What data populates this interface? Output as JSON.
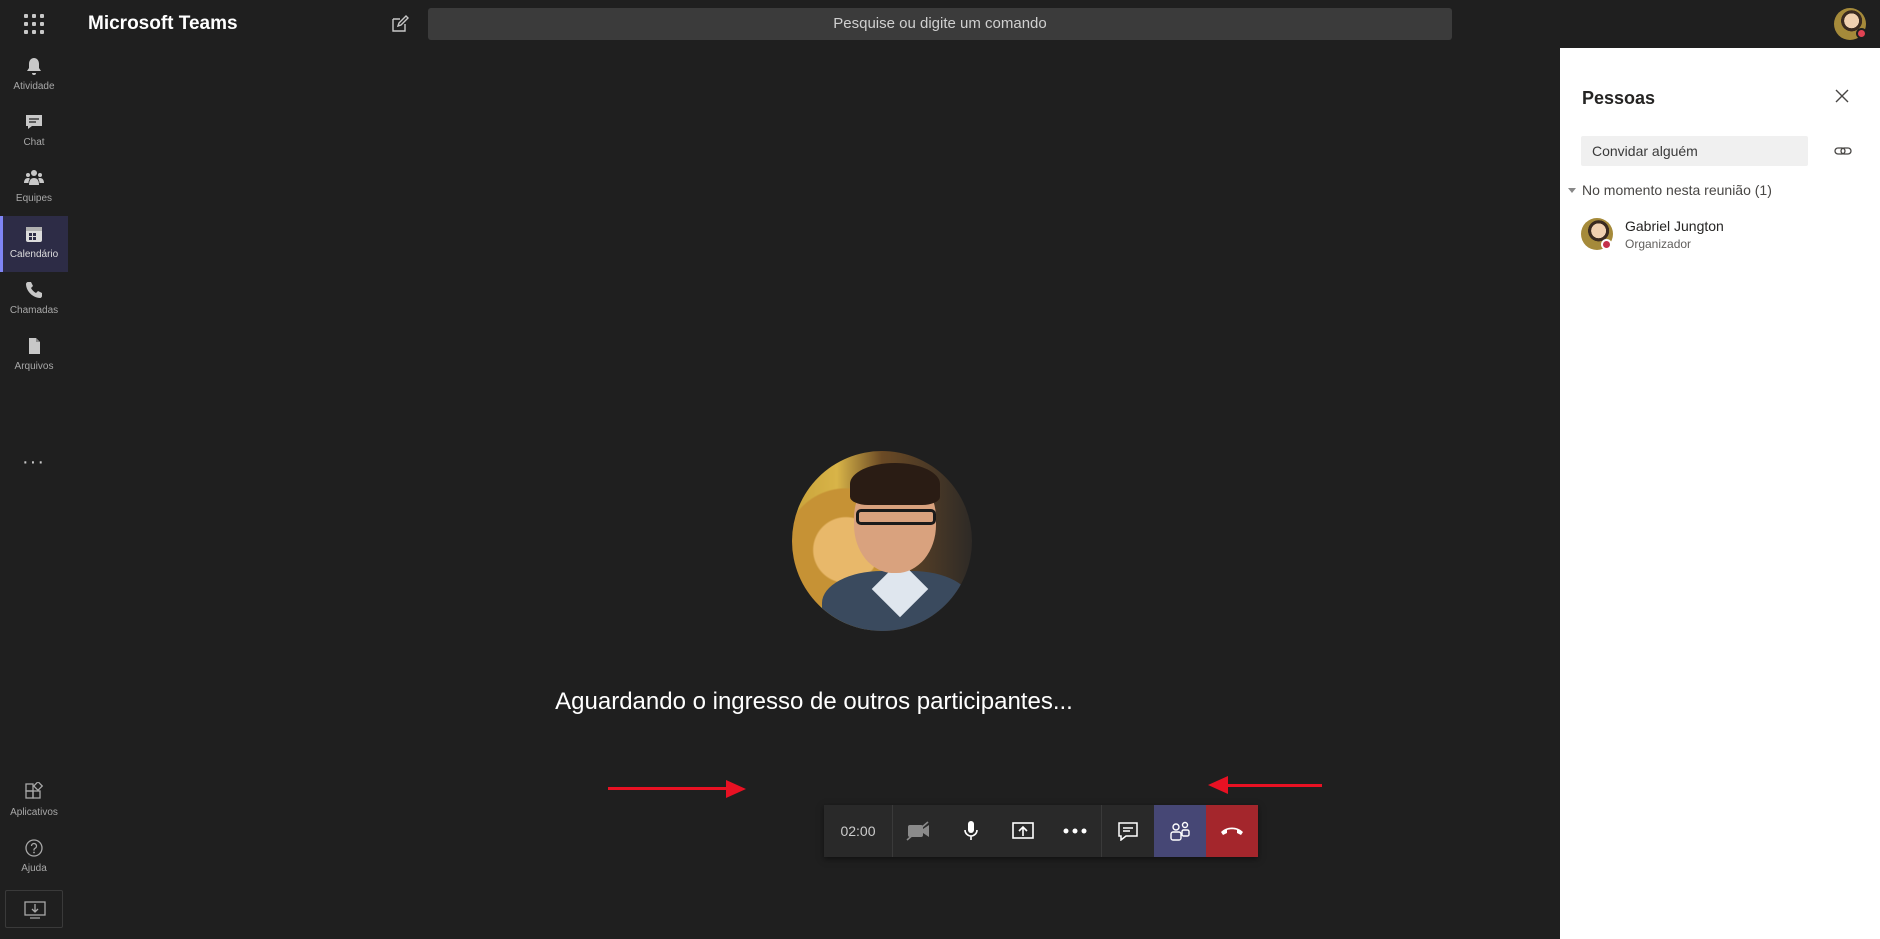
{
  "app": {
    "title": "Microsoft Teams"
  },
  "search": {
    "placeholder": "Pesquise ou digite um comando"
  },
  "rail": {
    "items": [
      {
        "label": "Atividade",
        "icon": "bell-icon"
      },
      {
        "label": "Chat",
        "icon": "chat-icon"
      },
      {
        "label": "Equipes",
        "icon": "teams-icon"
      },
      {
        "label": "Calendário",
        "icon": "calendar-icon",
        "active": true
      },
      {
        "label": "Chamadas",
        "icon": "phone-icon"
      },
      {
        "label": "Arquivos",
        "icon": "file-icon"
      }
    ],
    "more": "···",
    "bottom": [
      {
        "label": "Aplicativos",
        "icon": "apps-icon"
      },
      {
        "label": "Ajuda",
        "icon": "help-icon"
      }
    ]
  },
  "stage": {
    "waiting_text": "Aguardando o ingresso de outros participantes..."
  },
  "controls": {
    "timer": "02:00",
    "buttons": [
      "camera-off-icon",
      "mic-icon",
      "share-screen-icon",
      "more-icon",
      "chat-icon",
      "participants-icon",
      "hang-up-icon"
    ]
  },
  "panel": {
    "title": "Pessoas",
    "invite_placeholder": "Convidar alguém",
    "section_label": "No momento nesta reunião (1)",
    "participants": [
      {
        "name": "Gabriel Jungton",
        "role": "Organizador"
      }
    ]
  },
  "colors": {
    "background": "#1f1f1f",
    "accent": "#464775",
    "hangup": "#a4262c",
    "arrow": "#e81123"
  }
}
